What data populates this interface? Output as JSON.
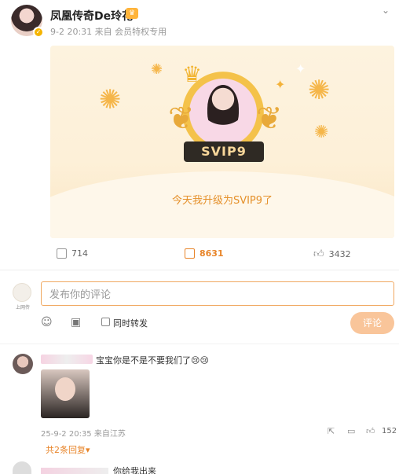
{
  "post": {
    "username": "凤凰传奇De玲花",
    "badge_icon": "crown-badge-icon",
    "meta": "9-2 20:31  来自  会员特权专用",
    "card": {
      "badge_text": "SVIP9",
      "caption": "今天我升级为SVIP9了"
    },
    "stats": {
      "reposts": "714",
      "comments": "8631",
      "likes": "3432"
    }
  },
  "composer": {
    "avatar_caption": "上网传",
    "placeholder": "发布你的评论",
    "repost_label": "同时转发",
    "submit_label": "评论"
  },
  "comments": [
    {
      "text": "宝宝你是不是不要我们了",
      "emojis": "😢😢",
      "meta": "25-9-2 20:35  来自江苏",
      "like_count": "152",
      "replies_label": "共2条回复▾"
    },
    {
      "text": "你给我出来"
    }
  ],
  "colors": {
    "accent": "#e8852a",
    "input_border": "#f0a860",
    "submit_bg": "#f9c59a"
  }
}
